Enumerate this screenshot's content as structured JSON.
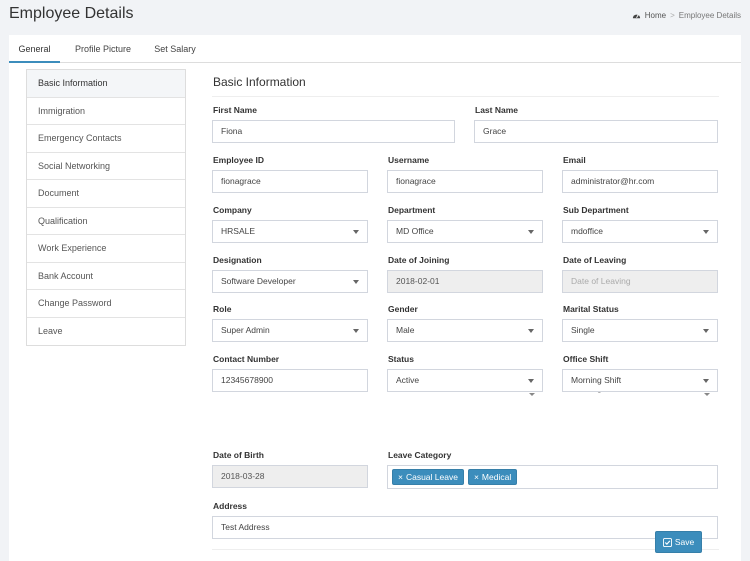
{
  "page": {
    "title": "Employee Details"
  },
  "breadcrumb": {
    "home": "Home",
    "current": "Employee Details"
  },
  "tabs": [
    {
      "label": "General",
      "active": true
    },
    {
      "label": "Profile Picture"
    },
    {
      "label": "Set Salary"
    }
  ],
  "sidebar": {
    "items": [
      {
        "label": "Basic Information",
        "active": true
      },
      {
        "label": "Immigration"
      },
      {
        "label": "Emergency Contacts"
      },
      {
        "label": "Social Networking"
      },
      {
        "label": "Document"
      },
      {
        "label": "Qualification"
      },
      {
        "label": "Work Experience"
      },
      {
        "label": "Bank Account"
      },
      {
        "label": "Change Password"
      },
      {
        "label": "Leave"
      }
    ]
  },
  "form": {
    "section_title": "Basic Information",
    "first_name": {
      "label": "First Name",
      "value": "Fiona"
    },
    "last_name": {
      "label": "Last Name",
      "value": "Grace"
    },
    "employee_id": {
      "label": "Employee ID",
      "value": "fionagrace"
    },
    "username": {
      "label": "Username",
      "value": "fionagrace"
    },
    "email": {
      "label": "Email",
      "value": "administrator@hr.com"
    },
    "company": {
      "label": "Company",
      "value": "HRSALE"
    },
    "department": {
      "label": "Department",
      "value": "MD Office"
    },
    "sub_department": {
      "label": "Sub Department",
      "value": "mdoffice"
    },
    "designation": {
      "label": "Designation",
      "value": "Software Developer"
    },
    "date_of_joining": {
      "label": "Date of Joining",
      "value": "2018-02-01"
    },
    "date_of_leaving": {
      "label": "Date of Leaving",
      "placeholder": "Date of Leaving"
    },
    "role": {
      "label": "Role",
      "value": "Super Admin"
    },
    "gender": {
      "label": "Gender",
      "value": "Male"
    },
    "marital_status": {
      "label": "Marital Status",
      "value": "Single"
    },
    "contact_number": {
      "label": "Contact Number",
      "value": "12345678900"
    },
    "status": {
      "label": "Status",
      "value": "Active"
    },
    "office_shift": {
      "label": "Office Shift",
      "value": "Morning Shift"
    },
    "date_of_birth": {
      "label": "Date of Birth",
      "value": "2018-03-28"
    },
    "leave_category": {
      "label": "Leave Category",
      "tags": [
        "Casual Leave",
        "Medical"
      ],
      "remove_symbol": "×"
    },
    "address": {
      "label": "Address",
      "value": "Test Address"
    },
    "save_label": "Save"
  },
  "colors": {
    "accent": "#3c8dbc",
    "background": "#f1f3f6"
  },
  "icons": {
    "breadcrumb_home": "dashboard-icon",
    "save": "check-square-icon"
  }
}
